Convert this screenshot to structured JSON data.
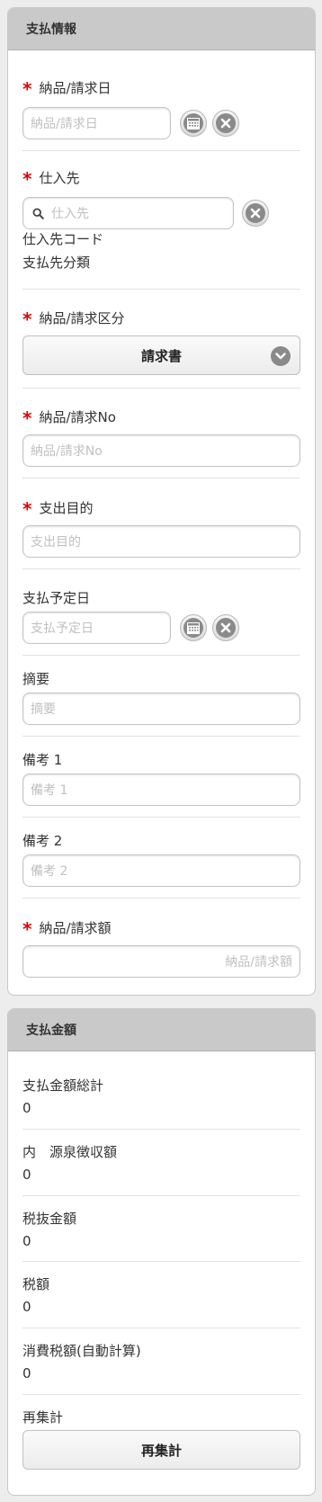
{
  "payment_info": {
    "header": "支払情報",
    "delivery_date": {
      "label": "納品/請求日",
      "placeholder": "納品/請求日"
    },
    "supplier": {
      "label": "仕入先",
      "placeholder": "仕入先",
      "code_label": "仕入先コード",
      "category_label": "支払先分類"
    },
    "delivery_type": {
      "label": "納品/請求区分",
      "value": "請求書"
    },
    "delivery_no": {
      "label": "納品/請求No",
      "placeholder": "納品/請求No"
    },
    "purpose": {
      "label": "支出目的",
      "placeholder": "支出目的"
    },
    "scheduled_date": {
      "label": "支払予定日",
      "placeholder": "支払予定日"
    },
    "summary": {
      "label": "摘要",
      "placeholder": "摘要"
    },
    "note1": {
      "label": "備考 1",
      "placeholder": "備考 1"
    },
    "note2": {
      "label": "備考 2",
      "placeholder": "備考 2"
    },
    "amount": {
      "label": "納品/請求額",
      "placeholder": "納品/請求額"
    }
  },
  "payment_amount": {
    "header": "支払金額",
    "total": {
      "label": "支払金額総計",
      "value": "0"
    },
    "withholding": {
      "label": "内　源泉徴収額",
      "value": "0"
    },
    "pretax": {
      "label": "税抜金額",
      "value": "0"
    },
    "tax": {
      "label": "税額",
      "value": "0"
    },
    "consumption_tax": {
      "label": "消費税額(自動計算)",
      "value": "0"
    },
    "recalc": {
      "label": "再集計",
      "button": "再集計"
    }
  },
  "colors": {
    "required": "#e00000",
    "header_bg": "#c9c9c9"
  }
}
